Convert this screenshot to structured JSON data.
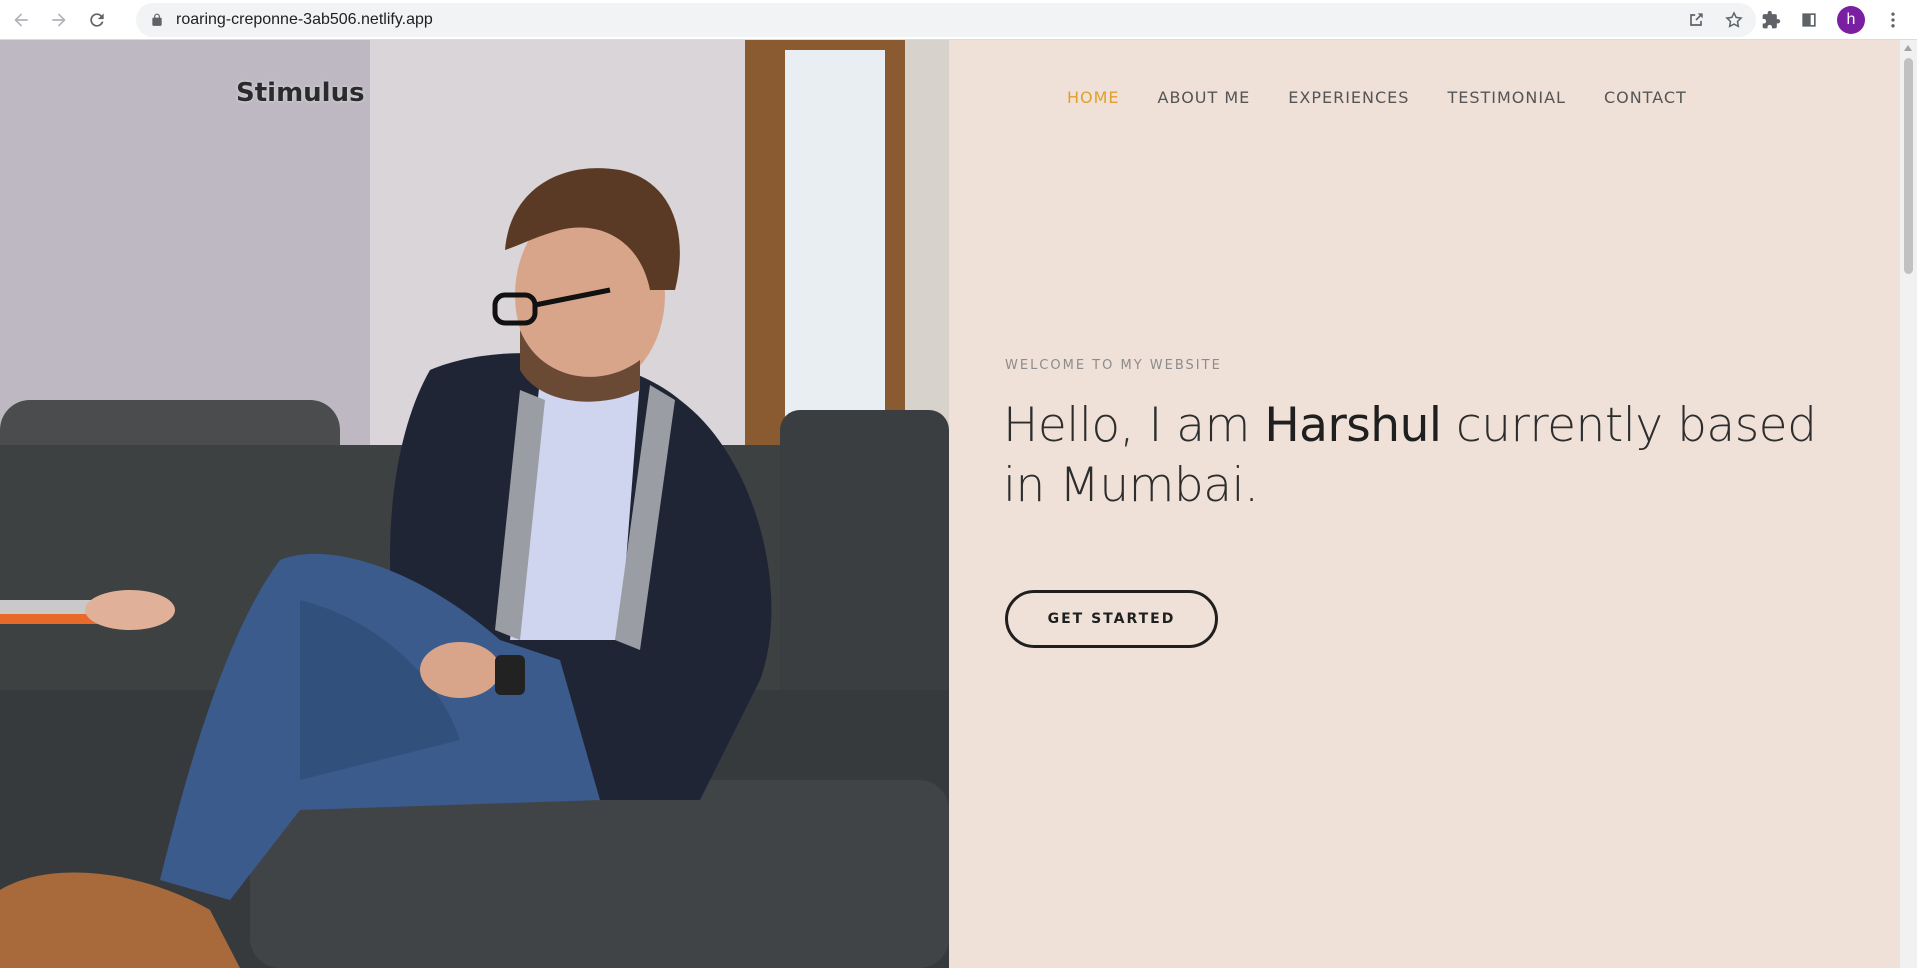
{
  "browser": {
    "url": "roaring-creponne-3ab506.netlify.app",
    "profile_initial": "h",
    "profile_color": "#7b1fa2",
    "icons": [
      "back-icon",
      "forward-icon",
      "reload-icon",
      "lock-icon",
      "share-icon",
      "star-icon",
      "extensions-icon",
      "side-panel-icon",
      "menu-icon"
    ]
  },
  "site": {
    "logo": "Stimulus",
    "nav": [
      {
        "label": "HOME",
        "active": true
      },
      {
        "label": "ABOUT ME",
        "active": false
      },
      {
        "label": "EXPERIENCES",
        "active": false
      },
      {
        "label": "TESTIMONIAL",
        "active": false
      },
      {
        "label": "CONTACT",
        "active": false
      }
    ],
    "hero": {
      "eyebrow": "WELCOME TO MY WEBSITE",
      "headline_pre": "Hello, I am ",
      "headline_name": "Harshul",
      "headline_post": " currently based in Mumbai.",
      "cta_label": "GET STARTED"
    }
  },
  "colors": {
    "accent": "#e0a030",
    "hero_background": "#efe1d8",
    "text_dark": "#2d2d2d"
  }
}
